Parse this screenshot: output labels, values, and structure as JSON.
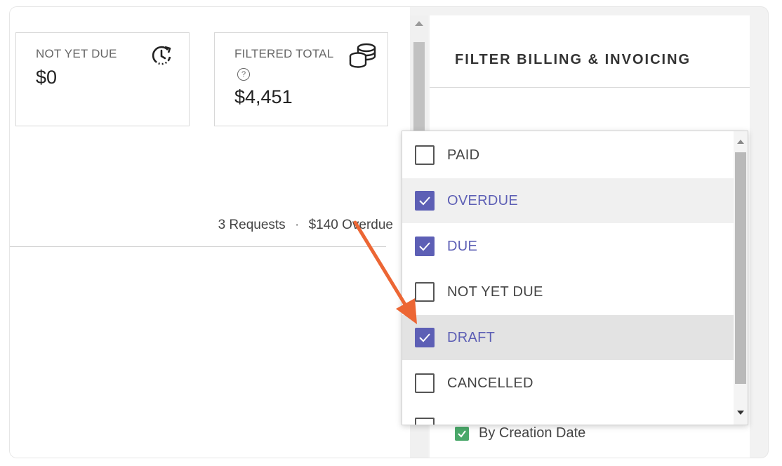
{
  "cards": {
    "not_yet_due": {
      "label": "NOT YET DUE",
      "value": "$0",
      "icon": "clock-rotate-icon"
    },
    "filtered_total": {
      "label": "FILTERED TOTAL",
      "help": "?",
      "value": "$4,451",
      "icon": "coins-stack-icon"
    }
  },
  "summary": {
    "requests": "3 Requests",
    "separator": "·",
    "overdue": "$140 Overdue"
  },
  "filter_panel": {
    "title": "FILTER BILLING & INVOICING",
    "behind_option_label": "By Creation Date"
  },
  "status_dropdown": {
    "options": [
      {
        "label": "PAID",
        "checked": false
      },
      {
        "label": "OVERDUE",
        "checked": true
      },
      {
        "label": "DUE",
        "checked": true
      },
      {
        "label": "NOT YET DUE",
        "checked": false
      },
      {
        "label": "DRAFT",
        "checked": true
      },
      {
        "label": "CANCELLED",
        "checked": false
      }
    ]
  },
  "colors": {
    "checkbox_checked": "#5d5fb5",
    "annotation_arrow": "#ec6634",
    "behind_checkbox": "#4aa86a"
  }
}
